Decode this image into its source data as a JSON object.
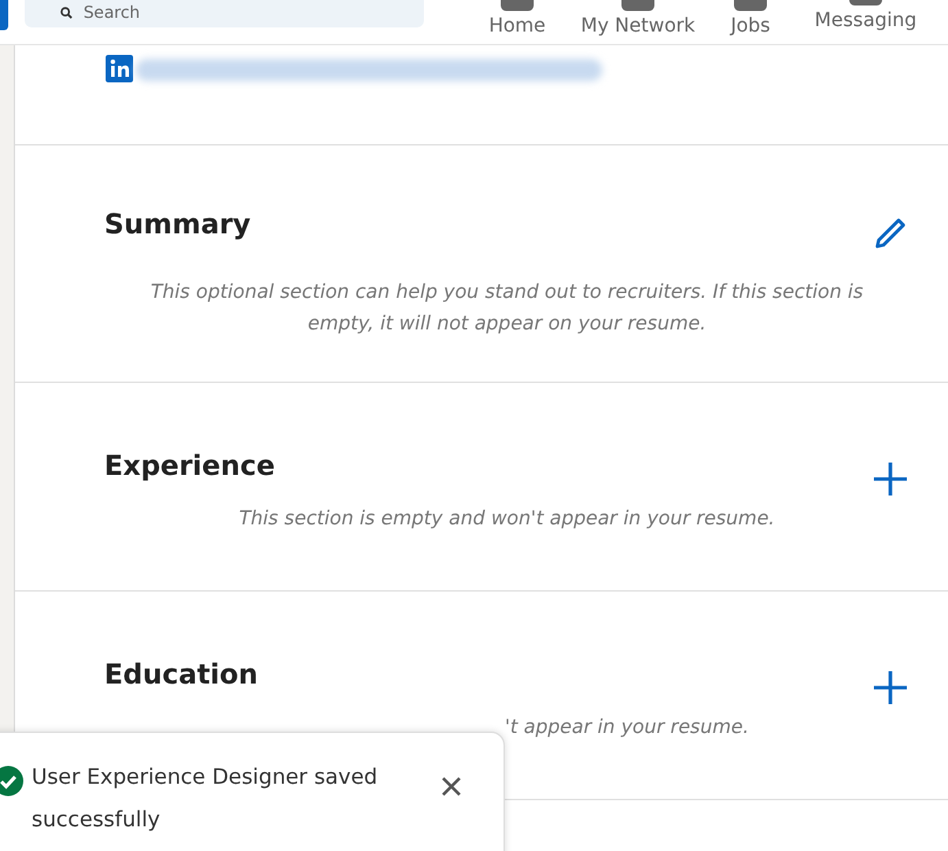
{
  "nav": {
    "search": {
      "placeholder": "Search"
    },
    "items": [
      {
        "label": "Home"
      },
      {
        "label": "My Network"
      },
      {
        "label": "Jobs"
      },
      {
        "label": "Messaging"
      }
    ]
  },
  "sections": [
    {
      "title": "Summary",
      "kind": "edit",
      "description": "This optional section can help you stand out to recruiters. If this section is empty, it will not appear on your resume."
    },
    {
      "title": "Experience",
      "kind": "add",
      "description": "This section is empty and won't appear in your resume."
    },
    {
      "title": "Education",
      "kind": "add",
      "description": "'t appear in your resume.",
      "partial": true
    }
  ],
  "toast": {
    "message": "User Experience Designer saved successfully"
  }
}
